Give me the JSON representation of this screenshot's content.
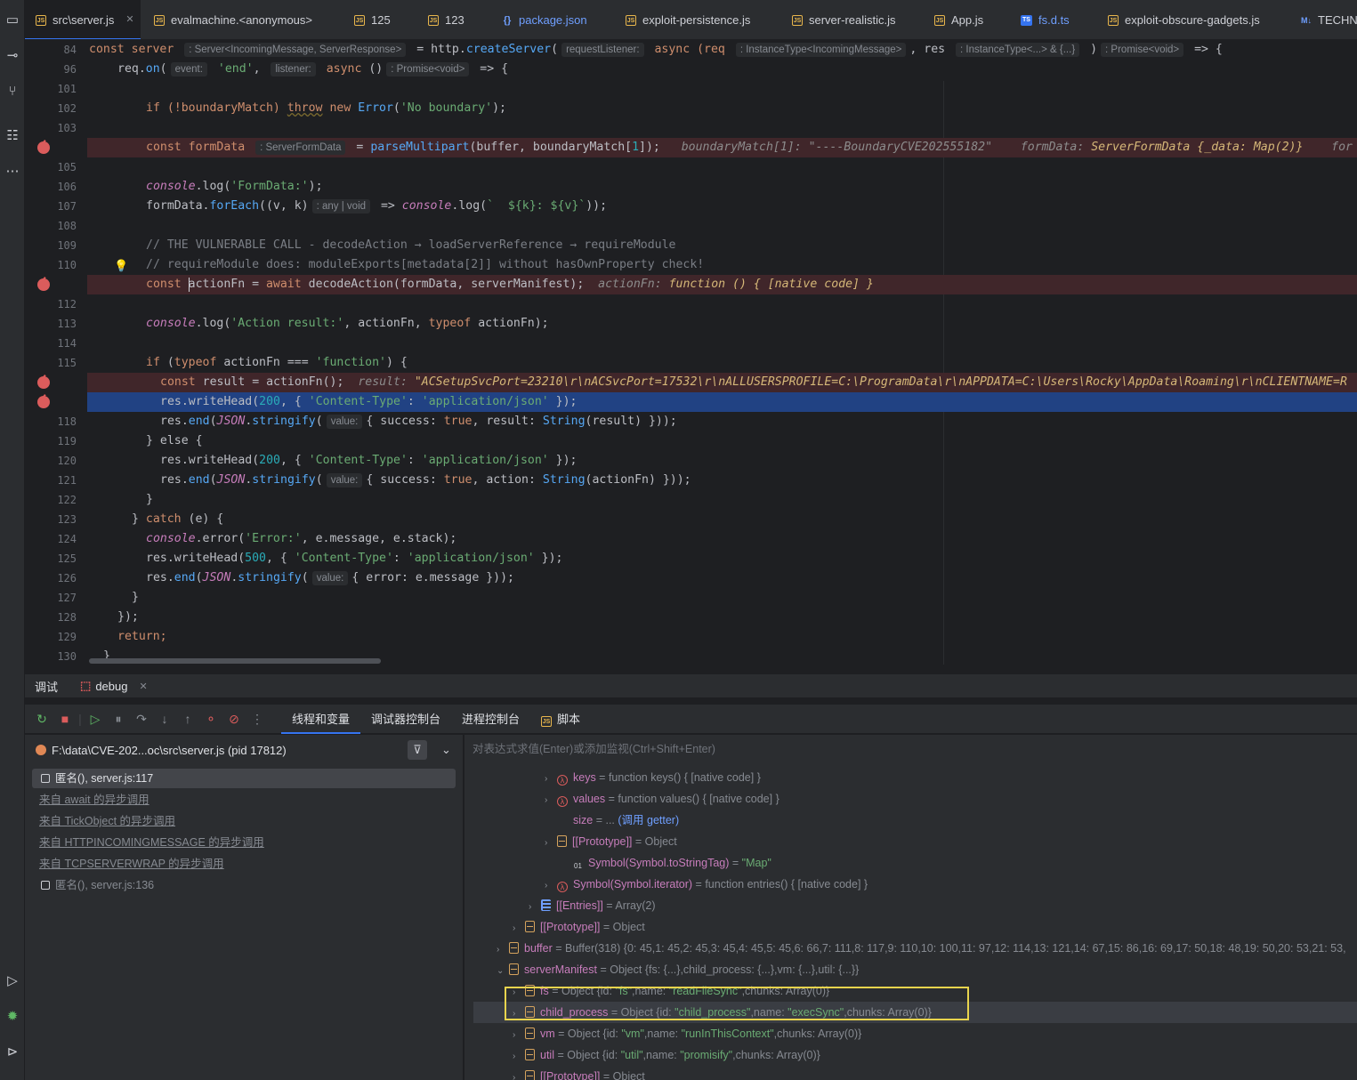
{
  "tabs": [
    {
      "name": "src\\server.js",
      "icon": "js",
      "active": true,
      "closable": true
    },
    {
      "name": "evalmachine.<anonymous>",
      "icon": "js"
    },
    {
      "name": "125",
      "icon": "js"
    },
    {
      "name": "123",
      "icon": "js"
    },
    {
      "name": "package.json",
      "icon": "json",
      "blue": true
    },
    {
      "name": "exploit-persistence.js",
      "icon": "js"
    },
    {
      "name": "server-realistic.js",
      "icon": "js"
    },
    {
      "name": "App.js",
      "icon": "js"
    },
    {
      "name": "fs.d.ts",
      "icon": "ts",
      "blue": true
    },
    {
      "name": "exploit-obscure-gadgets.js",
      "icon": "js"
    },
    {
      "name": "TECHN",
      "icon": "md"
    }
  ],
  "sticky": {
    "l84": {
      "num": "84",
      "a": "const server ",
      "h1": ": Server<IncomingMessage, ServerResponse>",
      "b": " = http.",
      "c": "createServer",
      "d": "(",
      "h2": "requestListener:",
      "e": " async (req ",
      "h3": ": InstanceType<IncomingMessage>",
      "f": ", res ",
      "h4": ": InstanceType<...> & {...}",
      "g": " )",
      "h5": ": Promise<void>",
      "i": " => {"
    },
    "l96": {
      "num": "96",
      "a": "req.",
      "b": "on",
      "c": "(",
      "h1": "event:",
      "d": " 'end'",
      "e": ", ",
      "h2": "listener:",
      "f": " async ",
      "g": "()",
      "h3": ": Promise<void>",
      "i": " => {"
    }
  },
  "code": {
    "l101": "101",
    "l102": "102",
    "l103": "103",
    "l104": "",
    "l105": "105",
    "l106": "106",
    "l107": "107",
    "l108": "108",
    "l109": "109",
    "l110": "110",
    "l111": "",
    "l112": "112",
    "l113": "113",
    "l114": "114",
    "l115": "115",
    "l116": "",
    "l117": "",
    "l118": "118",
    "l119": "119",
    "l120": "120",
    "l121": "121",
    "l122": "122",
    "l123": "123",
    "l124": "124",
    "l125": "125",
    "l126": "126",
    "l127": "127",
    "l128": "128",
    "l129": "129",
    "l130": "130",
    "c102a": "if (!boundaryMatch) ",
    "c102b": "throw",
    "c102c": " new ",
    "c102d": "Error",
    "c102e": "(",
    "c102f": "'No boundary'",
    "c102g": ");",
    "c104a": "const formData ",
    "c104h": ": ServerFormData",
    "c104b": " = ",
    "c104c": "parseMultipart",
    "c104d": "(buffer, boundaryMatch[",
    "c104e": "1",
    "c104f": "]);",
    "c104i1": "boundaryMatch[1]: \"----BoundaryCVE202555182\"",
    "c104i2": "formData: ",
    "c104i3": "ServerFormData {_data: Map(2)}",
    "c104i4": "for",
    "c106a": "console",
    "c106b": ".log(",
    "c106c": "'FormData:'",
    "c106d": ");",
    "c107a": "formData.",
    "c107b": "forEach",
    "c107c": "((v, k)",
    "c107h": ": any | void",
    "c107d": " => ",
    "c107e": "console",
    "c107f": ".log(",
    "c107g": "`  ${k}: ${v}`",
    "c107i": "));",
    "c109": "// THE VULNERABLE CALL - decodeAction → loadServerReference → requireModule",
    "c110": "// requireModule does: moduleExports[metadata[2]] without hasOwnProperty check!",
    "c111a": "const ",
    "c111b": "actionFn = ",
    "c111c": "await ",
    "c111d": "decodeAction(formData, serverManifest);",
    "c111i1": "actionFn: ",
    "c111i2": "function () { [native code] }",
    "c113a": "console",
    "c113b": ".log(",
    "c113c": "'Action result:'",
    "c113d": ", actionFn, ",
    "c113e": "typeof ",
    "c113f": "actionFn);",
    "c115a": "if ",
    "c115b": "(",
    "c115c": "typeof ",
    "c115d": "actionFn === ",
    "c115e": "'function'",
    "c115f": ") {",
    "c116a": "const ",
    "c116b": "result = actionFn();",
    "c116i1": "result: ",
    "c116i2": "\"ACSetupSvcPort=23210\\r\\nACSvcPort=17532\\r\\nALLUSERSPROFILE=C:\\ProgramData\\r\\nAPPDATA=C:\\Users\\Rocky\\AppData\\Roaming\\r\\nCLIENTNAME=R",
    "c117a": "res.writeHead(",
    "c117b": "200",
    "c117c": ", { ",
    "c117d": "'Content-Type'",
    "c117e": ": ",
    "c117f": "'application/json'",
    "c117g": " });",
    "c118a": "res.",
    "c118b": "end",
    "c118c": "(",
    "c118d": "JSON",
    "c118e": ".",
    "c118f": "stringify",
    "c118g": "(",
    "c118h": "value:",
    "c118i": "{ success: ",
    "c118j": "true",
    "c118k": ", result: ",
    "c118l": "String",
    "c118m": "(result) }));",
    "c119": "} else {",
    "c120a": "res.writeHead(",
    "c120b": "200",
    "c120c": ", { ",
    "c120d": "'Content-Type'",
    "c120e": ": ",
    "c120f": "'application/json'",
    "c120g": " });",
    "c121a": "res.",
    "c121b": "end",
    "c121c": "(",
    "c121d": "JSON",
    "c121e": ".",
    "c121f": "stringify",
    "c121g": "(",
    "c121h": "value:",
    "c121i": "{ success: ",
    "c121j": "true",
    "c121k": ", action: ",
    "c121l": "String",
    "c121m": "(actionFn) }));",
    "c122": "}",
    "c123a": "} ",
    "c123b": "catch ",
    "c123c": "(e) {",
    "c124a": "console",
    "c124b": ".error(",
    "c124c": "'Error:'",
    "c124d": ", e.message, e.stack);",
    "c125a": "res.writeHead(",
    "c125b": "500",
    "c125c": ", { ",
    "c125d": "'Content-Type'",
    "c125e": ": ",
    "c125f": "'application/json'",
    "c125g": " });",
    "c126a": "res.",
    "c126b": "end",
    "c126c": "(",
    "c126d": "JSON",
    "c126e": ".",
    "c126f": "stringify",
    "c126g": "(",
    "c126h": "value:",
    "c126i": "{ error: e.message }));",
    "c127": "}",
    "c128": "});",
    "c129": "return;",
    "c130": "}"
  },
  "debug": {
    "tab_main": "调试",
    "tab_config": "debug",
    "panel_tabs": [
      "线程和变量",
      "调试器控制台",
      "进程控制台",
      "脚本"
    ],
    "process": "F:\\data\\CVE-202...oc\\src\\server.js (pid 17812)",
    "frames": [
      "匿名(), server.js:117",
      "来自 await 的异步调用",
      "来自 TickObject 的异步调用",
      "来自 HTTPINCOMINGMESSAGE 的异步调用",
      "来自 TCPSERVERWRAP 的异步调用",
      "匿名(), server.js:136"
    ],
    "eval_placeholder": "对表达式求值(Enter)或添加监视(Ctrl+Shift+Enter)"
  },
  "vars": {
    "v1n": "keys",
    "v1v": " = function keys() { [native code] }",
    "v2n": "values",
    "v2v": " = function values() { [native code] }",
    "v3n": "size",
    "v3v": " = ... ",
    "v3l": "(调用 getter)",
    "v4n": "[[Prototype]]",
    "v4v": " = Object",
    "v5n": "Symbol(Symbol.toStringTag)",
    "v5e": " = ",
    "v5s": "\"Map\"",
    "v6n": "Symbol(Symbol.iterator)",
    "v6v": " = function entries() { [native code] }",
    "v7n": "[[Entries]]",
    "v7v": " = Array(2)",
    "v8n": "[[Prototype]]",
    "v8v": " = Object",
    "v9n": "buffer",
    "v9v": " = Buffer(318) {0: 45,1: 45,2: 45,3: 45,4: 45,5: 45,6: 66,7: 111,8: 117,9: 110,10: 100,11: 97,12: 114,13: 121,14: 67,15: 86,16: 69,17: 50,18: 48,19: 50,20: 53,21: 53,",
    "v10n": "serverManifest",
    "v10v": " = Object {fs: {...},child_process: {...},vm: {...},util: {...}}",
    "v11n": "fs",
    "v11a": " = Object {id: ",
    "v11b": "\"fs\"",
    "v11c": ",name: ",
    "v11d": "\"readFileSync\"",
    "v11e": ",chunks: Array(0)}",
    "v12n": "child_process",
    "v12a": " = Object {id: ",
    "v12b": "\"child_process\"",
    "v12c": ",name: ",
    "v12d": "\"execSync\"",
    "v12e": ",chunks: Array(0)}",
    "v13n": "vm",
    "v13a": " = Object {id: ",
    "v13b": "\"vm\"",
    "v13c": ",name: ",
    "v13d": "\"runInThisContext\"",
    "v13e": ",chunks: Array(0)}",
    "v14n": "util",
    "v14a": " = Object {id: ",
    "v14b": "\"util\"",
    "v14c": ",name: ",
    "v14d": "\"promisify\"",
    "v14e": ",chunks: Array(0)}",
    "v15n": "[[Prototype]]",
    "v15v": " = Object"
  }
}
